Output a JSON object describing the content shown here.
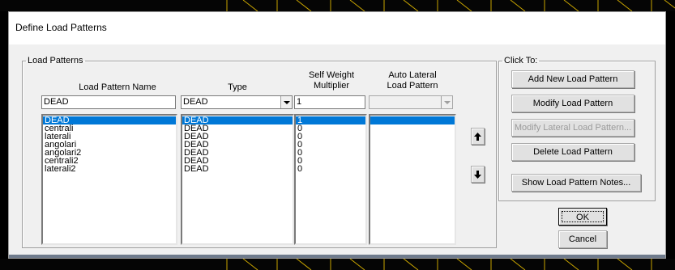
{
  "dialog": {
    "title": "Define Load Patterns"
  },
  "load_patterns": {
    "group_label": "Load Patterns",
    "headers": {
      "name": "Load Pattern Name",
      "type": "Type",
      "self_weight_line1": "Self Weight",
      "self_weight_line2": "Multiplier",
      "auto_lateral_line1": "Auto Lateral",
      "auto_lateral_line2": "Load Pattern"
    },
    "edit": {
      "name": "DEAD",
      "type": "DEAD",
      "multiplier": "1",
      "auto_lateral": ""
    },
    "rows": [
      {
        "name": "DEAD",
        "type": "DEAD",
        "multiplier": "1",
        "selected": true
      },
      {
        "name": "centrali",
        "type": "DEAD",
        "multiplier": "0"
      },
      {
        "name": "laterali",
        "type": "DEAD",
        "multiplier": "0"
      },
      {
        "name": "angolari",
        "type": "DEAD",
        "multiplier": "0"
      },
      {
        "name": "angolari2",
        "type": "DEAD",
        "multiplier": "0"
      },
      {
        "name": "centrali2",
        "type": "DEAD",
        "multiplier": "0"
      },
      {
        "name": "laterali2",
        "type": "DEAD",
        "multiplier": "0"
      }
    ],
    "move_up_icon": "arrow-up-icon",
    "move_down_icon": "arrow-down-icon"
  },
  "click_to": {
    "group_label": "Click To:",
    "add": "Add New Load Pattern",
    "modify": "Modify Load Pattern",
    "modify_lateral": "Modify Lateral Load Pattern...",
    "delete": "Delete Load Pattern",
    "show_notes": "Show Load Pattern Notes..."
  },
  "footer": {
    "ok": "OK",
    "cancel": "Cancel"
  },
  "colors": {
    "selection": "#0078d7",
    "dialog_bg": "#f0f0f0",
    "backdrop_stripe": "#c8a400"
  }
}
